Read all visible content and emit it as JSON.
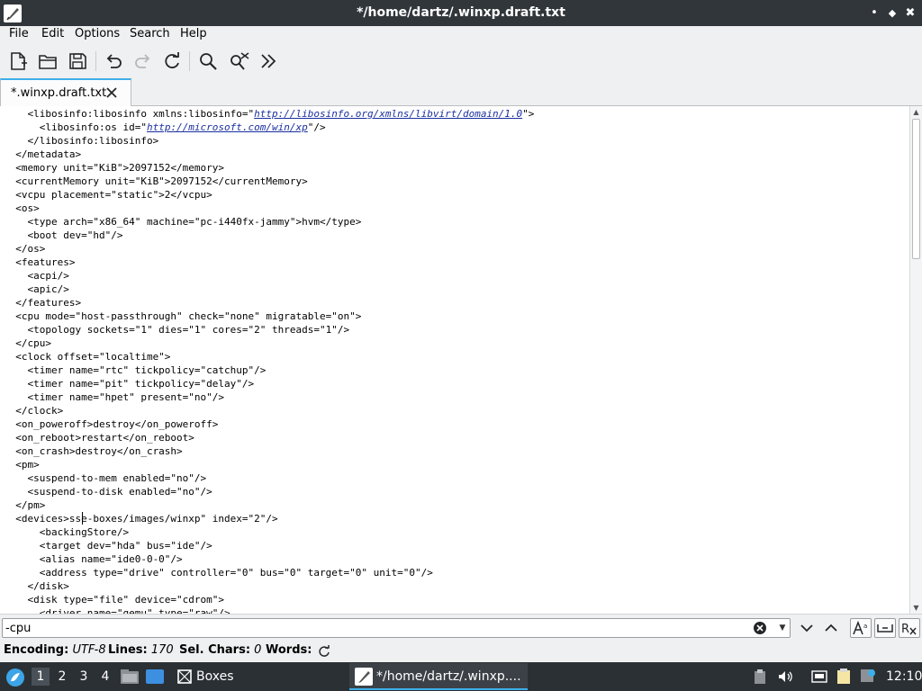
{
  "window": {
    "title": "*/home/dartz/.winxp.draft.txt",
    "controls": {
      "minimize": "•",
      "maximize": "◆",
      "close": "✖"
    }
  },
  "menu": [
    "File",
    "Edit",
    "Options",
    "Search",
    "Help"
  ],
  "toolbar": {
    "buttons": [
      "new-document",
      "open-folder",
      "save",
      "undo",
      "redo",
      "reload",
      "find",
      "find-replace",
      "more"
    ]
  },
  "tab": {
    "label": "*.winxp.draft.txt"
  },
  "editor": {
    "lines": [
      [
        "    <libosinfo:libosinfo xmlns:libosinfo=\"",
        "http://libosinfo.org/xmlns/libvirt/domain/1.0",
        "\">"
      ],
      [
        "      <libosinfo:os id=\"",
        "http://microsoft.com/win/xp",
        "\"/>"
      ],
      [
        "    </libosinfo:libosinfo>",
        "",
        ""
      ],
      [
        "  </metadata>",
        "",
        ""
      ],
      [
        "  <memory unit=\"KiB\">2097152</memory>",
        "",
        ""
      ],
      [
        "  <currentMemory unit=\"KiB\">2097152</currentMemory>",
        "",
        ""
      ],
      [
        "  <vcpu placement=\"static\">2</vcpu>",
        "",
        ""
      ],
      [
        "  <os>",
        "",
        ""
      ],
      [
        "    <type arch=\"x86_64\" machine=\"pc-i440fx-jammy\">hvm</type>",
        "",
        ""
      ],
      [
        "    <boot dev=\"hd\"/>",
        "",
        ""
      ],
      [
        "  </os>",
        "",
        ""
      ],
      [
        "  <features>",
        "",
        ""
      ],
      [
        "    <acpi/>",
        "",
        ""
      ],
      [
        "    <apic/>",
        "",
        ""
      ],
      [
        "  </features>",
        "",
        ""
      ],
      [
        "  <cpu mode=\"host-passthrough\" check=\"none\" migratable=\"on\">",
        "",
        ""
      ],
      [
        "    <topology sockets=\"1\" dies=\"1\" cores=\"2\" threads=\"1\"/>",
        "",
        ""
      ],
      [
        "  </cpu>",
        "",
        ""
      ],
      [
        "  <clock offset=\"localtime\">",
        "",
        ""
      ],
      [
        "    <timer name=\"rtc\" tickpolicy=\"catchup\"/>",
        "",
        ""
      ],
      [
        "    <timer name=\"pit\" tickpolicy=\"delay\"/>",
        "",
        ""
      ],
      [
        "    <timer name=\"hpet\" present=\"no\"/>",
        "",
        ""
      ],
      [
        "  </clock>",
        "",
        ""
      ],
      [
        "  <on_poweroff>destroy</on_poweroff>",
        "",
        ""
      ],
      [
        "  <on_reboot>restart</on_reboot>",
        "",
        ""
      ],
      [
        "  <on_crash>destroy</on_crash>",
        "",
        ""
      ],
      [
        "  <pm>",
        "",
        ""
      ],
      [
        "    <suspend-to-mem enabled=\"no\"/>",
        "",
        ""
      ],
      [
        "    <suspend-to-disk enabled=\"no\"/>",
        "",
        ""
      ],
      [
        "  </pm>",
        "",
        ""
      ],
      [
        "  <devices>sse-boxes/images/winxp\" index=\"2\"/>",
        "",
        ""
      ],
      [
        "      <backingStore/>",
        "",
        ""
      ],
      [
        "      <target dev=\"hda\" bus=\"ide\"/>",
        "",
        ""
      ],
      [
        "      <alias name=\"ide0-0-0\"/>",
        "",
        ""
      ],
      [
        "      <address type=\"drive\" controller=\"0\" bus=\"0\" target=\"0\" unit=\"0\"/>",
        "",
        ""
      ],
      [
        "    </disk>",
        "",
        ""
      ],
      [
        "    <disk type=\"file\" device=\"cdrom\">",
        "",
        ""
      ],
      [
        "      <driver name=\"qemu\" type=\"raw\"/>",
        "",
        ""
      ]
    ]
  },
  "search": {
    "value": "-cpu"
  },
  "status": {
    "encoding_label": "Encoding:",
    "encoding": "UTF-8",
    "lines_label": "Lines:",
    "lines": "170",
    "sel_label": "Sel. Chars:",
    "sel": "0",
    "words_label": "Words:"
  },
  "taskbar": {
    "workspaces": [
      "1",
      "2",
      "3",
      "4"
    ],
    "active_workspace": "1",
    "boxes_label": "Boxes",
    "window_label": "*/home/dartz/.winxp....",
    "clock": "12:10"
  },
  "colors": {
    "accent": "#3daee9",
    "titlebar": "#31363b",
    "taskbar": "#2b3035",
    "link": "#1a2ea0"
  }
}
